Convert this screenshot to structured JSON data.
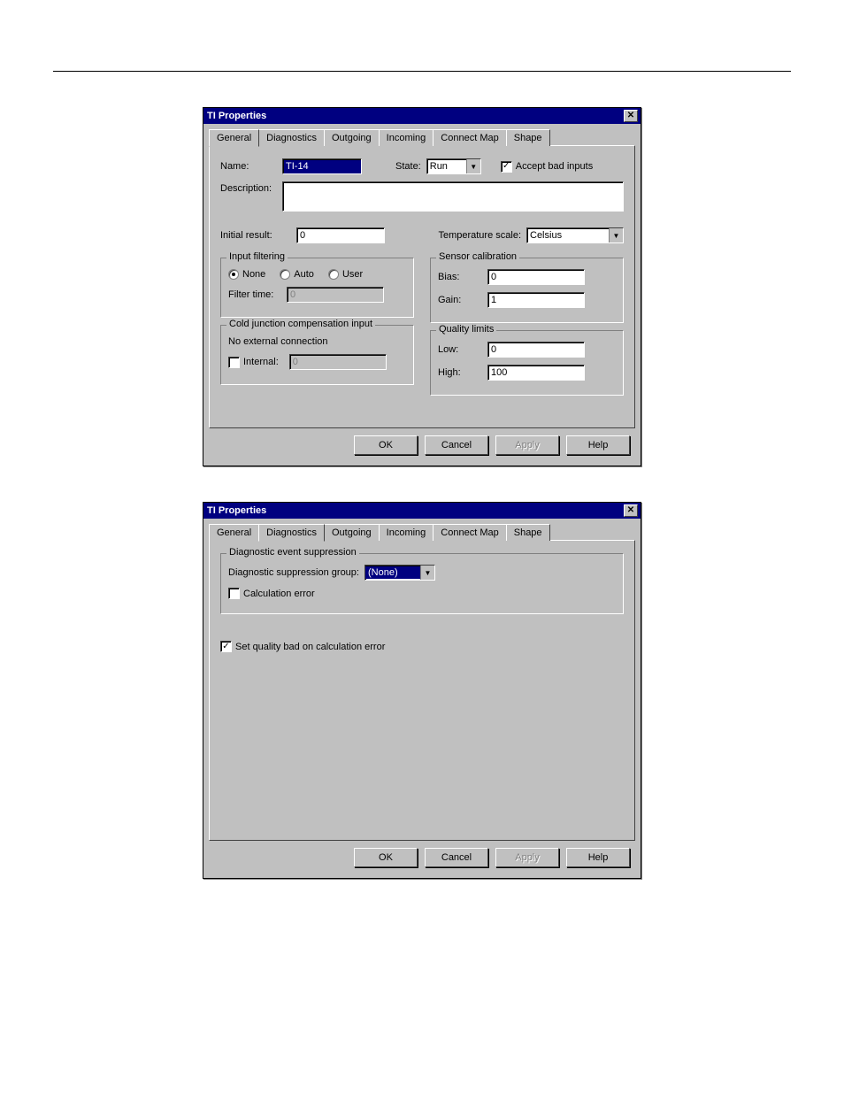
{
  "dialog1": {
    "title": "TI Properties",
    "tabs": [
      "General",
      "Diagnostics",
      "Outgoing",
      "Incoming",
      "Connect Map",
      "Shape"
    ],
    "active_tab": 0,
    "labels": {
      "name": "Name:",
      "state": "State:",
      "accept_bad": "Accept bad inputs",
      "description": "Description:",
      "initial_result": "Initial result:",
      "temp_scale": "Temperature scale:",
      "input_filtering": "Input filtering",
      "none": "None",
      "auto": "Auto",
      "user": "User",
      "filter_time": "Filter time:",
      "cjc": "Cold junction compensation input",
      "no_ext": "No external connection",
      "internal": "Internal:",
      "sensor_cal": "Sensor calibration",
      "bias": "Bias:",
      "gain": "Gain:",
      "quality_limits": "Quality limits",
      "low": "Low:",
      "high": "High:"
    },
    "values": {
      "name": "TI-14",
      "state": "Run",
      "accept_bad_checked": true,
      "description": "",
      "initial_result": "0",
      "temp_scale": "Celsius",
      "filter_radio": "None",
      "filter_time": "0",
      "internal_checked": false,
      "internal_value": "0",
      "bias": "0",
      "gain": "1",
      "low": "0",
      "high": "100"
    },
    "buttons": {
      "ok": "OK",
      "cancel": "Cancel",
      "apply": "Apply",
      "help": "Help"
    }
  },
  "dialog2": {
    "title": "TI Properties",
    "tabs": [
      "General",
      "Diagnostics",
      "Outgoing",
      "Incoming",
      "Connect Map",
      "Shape"
    ],
    "active_tab": 1,
    "labels": {
      "group": "Diagnostic event suppression",
      "supp_group": "Diagnostic suppression group:",
      "calc_error": "Calculation error",
      "set_quality": "Set quality bad on calculation error"
    },
    "values": {
      "supp_group": "(None)",
      "calc_error_checked": false,
      "set_quality_checked": true
    },
    "buttons": {
      "ok": "OK",
      "cancel": "Cancel",
      "apply": "Apply",
      "help": "Help"
    }
  }
}
